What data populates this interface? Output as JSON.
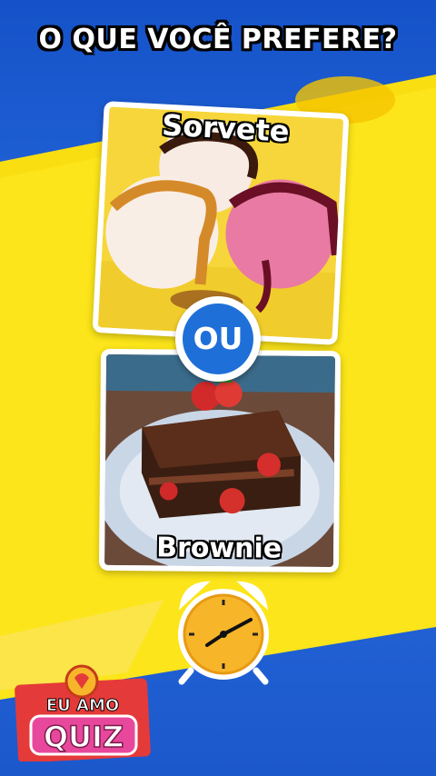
{
  "title": "O QUE VOCÊ PREFERE?",
  "option_1": {
    "label": "Sorvete",
    "image": "ice-cream-scoops"
  },
  "separator": "OU",
  "option_2": {
    "label": "Brownie",
    "image": "chocolate-brownie-with-strawberries"
  },
  "timer": {
    "icon": "alarm-clock-icon"
  },
  "logo": {
    "line_1": "EU AMO",
    "line_2": "QUIZ"
  },
  "colors": {
    "blue": "#1f6fd8",
    "yellow": "#fce51a",
    "accent_red": "#e53a3a"
  }
}
